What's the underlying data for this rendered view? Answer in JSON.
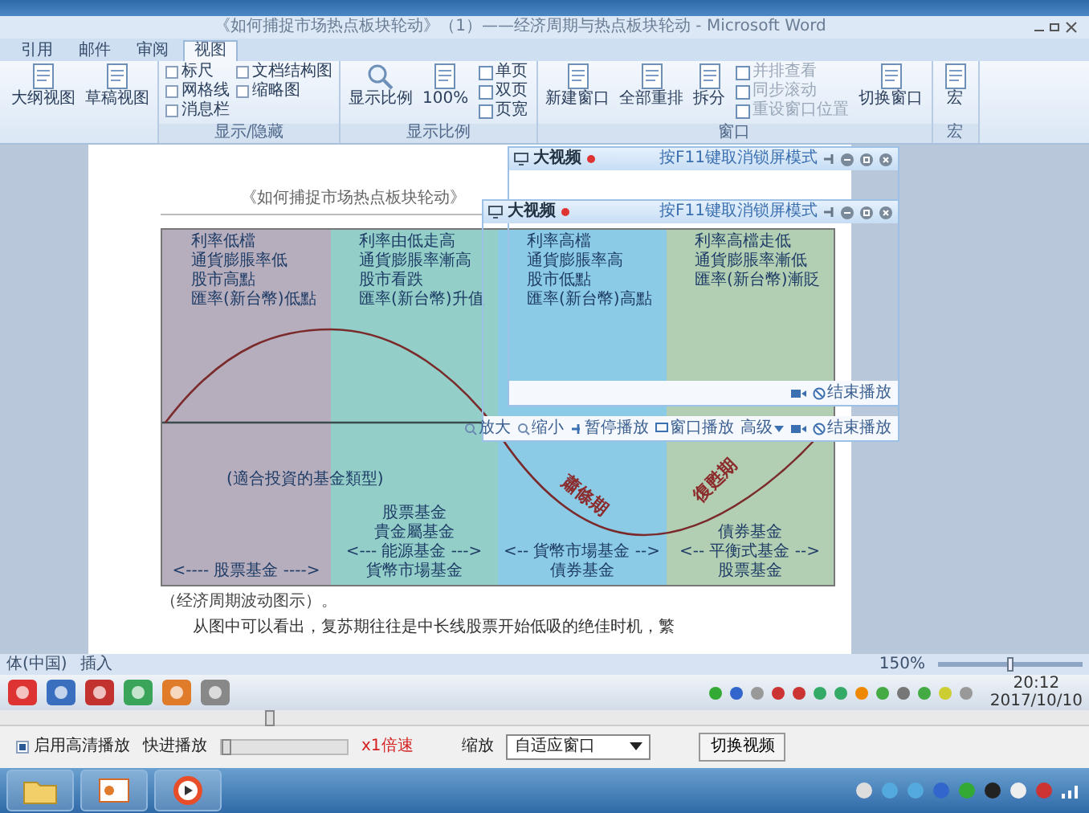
{
  "window": {
    "title": "《如何捕捉市场热点板块轮动》（1）——经济周期与热点板块轮动 - Microsoft Word"
  },
  "ribbon": {
    "tabs": [
      {
        "label": "引用",
        "selected": false
      },
      {
        "label": "邮件",
        "selected": false
      },
      {
        "label": "审阅",
        "selected": false
      },
      {
        "label": "视图",
        "selected": true
      }
    ],
    "groups": [
      {
        "columns": [
          [
            {
              "kind": "large",
              "label": "大纲视图",
              "disabled": false
            }
          ],
          [
            {
              "kind": "large",
              "label": "草稿视图",
              "disabled": false
            }
          ]
        ]
      },
      {
        "label": "显示/隐藏",
        "columns": [
          [
            {
              "kind": "check",
              "label": "标尺",
              "checked": false
            },
            {
              "kind": "check",
              "label": "网格线",
              "checked": false
            },
            {
              "kind": "check",
              "label": "消息栏",
              "checked": false
            }
          ],
          [
            {
              "kind": "check",
              "label": "文档结构图",
              "checked": false
            },
            {
              "kind": "check",
              "label": "缩略图",
              "checked": false
            }
          ]
        ]
      },
      {
        "label": "显示比例",
        "columns": [
          [
            {
              "kind": "zoom",
              "label": "显示比例",
              "disabled": false
            }
          ],
          [
            {
              "kind": "large",
              "label": "100%",
              "disabled": false
            }
          ],
          [
            {
              "kind": "small",
              "label": "单页",
              "disabled": false
            },
            {
              "kind": "small",
              "label": "双页",
              "disabled": false
            },
            {
              "kind": "small",
              "label": "页宽",
              "disabled": false
            }
          ]
        ]
      },
      {
        "label": "窗口",
        "columns": [
          [
            {
              "kind": "large",
              "label": "新建窗口",
              "disabled": false
            }
          ],
          [
            {
              "kind": "large",
              "label": "全部重排",
              "disabled": false
            }
          ],
          [
            {
              "kind": "large",
              "label": "拆分",
              "disabled": false
            }
          ],
          [
            {
              "kind": "small",
              "label": "并排查看",
              "disabled": true
            },
            {
              "kind": "small",
              "label": "同步滚动",
              "disabled": true
            },
            {
              "kind": "small",
              "label": "重设窗口位置",
              "disabled": true
            }
          ],
          [
            {
              "kind": "large",
              "label": "切换窗口",
              "disabled": false
            }
          ]
        ]
      },
      {
        "label": "宏",
        "columns": [
          [
            {
              "kind": "large",
              "label": "宏",
              "disabled": false
            }
          ]
        ]
      }
    ]
  },
  "document": {
    "header": "《如何捕捉市场热点板块轮动》",
    "diagram": {
      "columns": [
        {
          "color": "#b6adbd",
          "top_lines": [
            "利率低檔",
            "通貨膨脹率低",
            "股市高點",
            "匯率(新台幣)低點"
          ],
          "bottom_lines": [
            "<---- 股票基金 ---->"
          ]
        },
        {
          "color": "#93cfc8",
          "top_lines": [
            "利率由低走高",
            "通貨膨脹率漸高",
            "股市看跌",
            "匯率(新台幣)升值"
          ],
          "bottom_lines": [
            "股票基金",
            "貴金屬基金",
            "<--- 能源基金 --->",
            "貨幣市場基金"
          ]
        },
        {
          "color": "#8ccbe6",
          "top_lines": [
            "利率高檔",
            "通貨膨脹率高",
            "股市低點",
            "匯率(新台幣)高點"
          ],
          "bottom_lines": [
            "<-- 貨幣市場基金 -->",
            "債券基金"
          ]
        },
        {
          "color": "#b3cfb3",
          "top_lines": [
            "利率高檔走低",
            "通貨膨脹率漸低",
            "匯率(新台幣)漸貶"
          ],
          "bottom_lines": [
            "債券基金",
            "<-- 平衡式基金 -->",
            "股票基金"
          ]
        }
      ],
      "note": "(適合投資的基金類型)",
      "phases": [
        "蕭條期",
        "復甦期"
      ]
    },
    "caption": "（经济周期波动图示）。",
    "paragraph": "从图中可以看出，复苏期往往是中长线股票开始低吸的绝佳时机，繁"
  },
  "video_windows": [
    {
      "title": "大视频",
      "hint": "按F11键取消锁屏模式",
      "toolbar": [
        {
          "kind": "camera"
        },
        {
          "kind": "stop",
          "label": "结束播放"
        }
      ]
    },
    {
      "title": "大视频",
      "hint": "按F11键取消锁屏模式",
      "toolbar": [
        {
          "kind": "magnifier",
          "label": "放大"
        },
        {
          "kind": "magnifier",
          "label": "缩小"
        },
        {
          "kind": "pin",
          "label": "暂停播放"
        },
        {
          "kind": "screen",
          "label": "窗口播放"
        },
        {
          "kind": "dropdown",
          "label": "高级"
        },
        {
          "kind": "camera"
        },
        {
          "kind": "stop",
          "label": "结束播放"
        }
      ]
    }
  ],
  "word_status": {
    "language": "体(中国)",
    "mode": "插入",
    "zoom": "150%",
    "zoom_slider": {
      "level": 0.5
    }
  },
  "inner_taskbar": {
    "time": "20:12",
    "date": "2017/10/10"
  },
  "player": {
    "progress": {
      "level": 0.245
    },
    "hd": {
      "label": "启用高清播放",
      "checked": true
    },
    "fast": {
      "label": "快进播放",
      "slider": {
        "level": 0
      }
    },
    "speed": "x1倍速",
    "scale_label": "缩放",
    "scale_value": "自适应窗口",
    "switch": "切换视频"
  }
}
